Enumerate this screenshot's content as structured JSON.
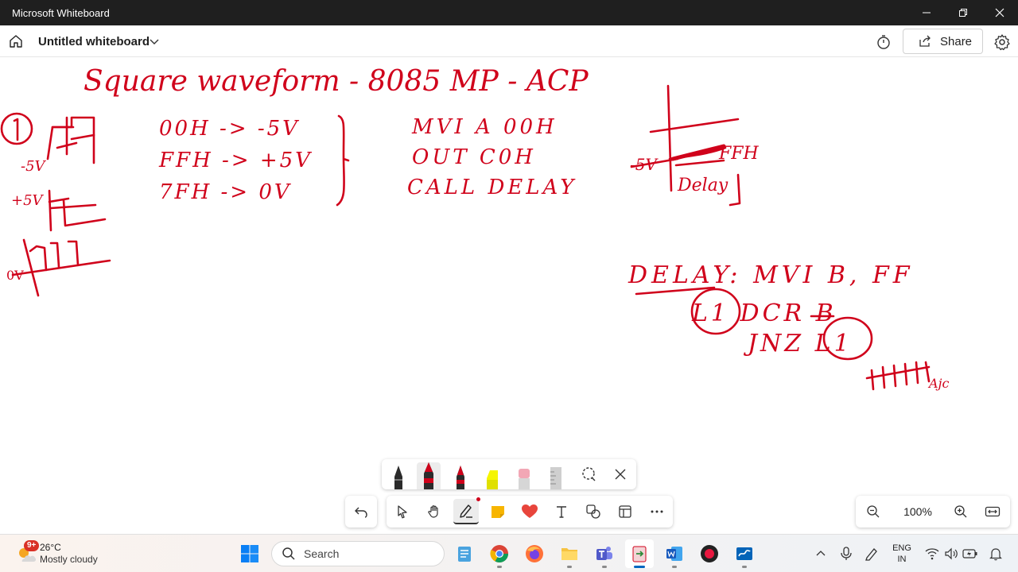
{
  "window": {
    "title": "Microsoft Whiteboard",
    "controls": [
      "minimize-icon",
      "restore-icon",
      "close-icon"
    ]
  },
  "header": {
    "board_title": "Untitled whiteboard",
    "share_label": "Share"
  },
  "canvas": {
    "ink_color": "#d0021b",
    "handwritten_notes": {
      "heading": "Square waveform - 8085 MP - ACP",
      "levels_table": [
        "00H -> -5V",
        "FFH -> +5V",
        "7FH -> 0V"
      ],
      "program": [
        "MVI A 00H",
        "OUT C0H",
        "CALL DELAY"
      ],
      "delay_routine": [
        "DELAY: MVI B, FF",
        "L1 DCR B",
        "JNZ L1"
      ],
      "graph_labels": [
        "-5V",
        "FFH",
        "Delay"
      ],
      "waveform_labels": [
        "1",
        "-5V",
        "+5V",
        "0V"
      ],
      "note": "Ajc"
    }
  },
  "pen_tray": {
    "pens": [
      {
        "name": "black-pen",
        "color": "#1f1f1f"
      },
      {
        "name": "red-pen",
        "color": "#d0021b",
        "selected": true
      },
      {
        "name": "red-pen-2",
        "color": "#d0021b"
      },
      {
        "name": "yellow-highlighter",
        "color": "#f5f500"
      },
      {
        "name": "eraser",
        "color": "#f2a7b5"
      },
      {
        "name": "ruler",
        "color": "#c8c8c8"
      }
    ]
  },
  "toolbar": {
    "tools": [
      "undo",
      "select",
      "pan",
      "inking",
      "sticky-note",
      "reactions",
      "text",
      "shapes",
      "templates",
      "more"
    ]
  },
  "zoom": {
    "level": "100%"
  },
  "taskbar": {
    "weather": {
      "badge": "9+",
      "temp": "26°C",
      "condition": "Mostly cloudy"
    },
    "search_placeholder": "Search",
    "apps": [
      "notepad",
      "chrome",
      "firefox",
      "file-explorer",
      "teams",
      "whiteboard-export",
      "word",
      "recorder",
      "whiteboard"
    ],
    "language": {
      "line1": "ENG",
      "line2": "IN"
    }
  }
}
